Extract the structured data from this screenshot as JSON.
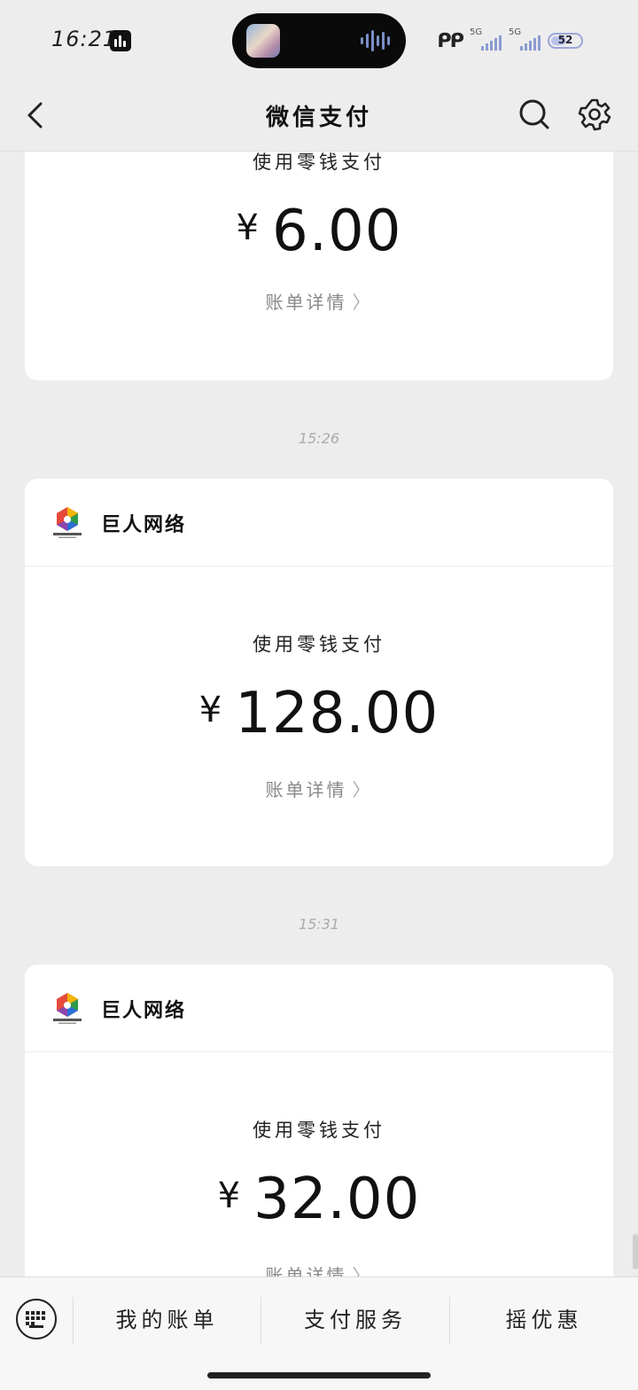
{
  "status_bar": {
    "time": "16:21",
    "signal1_label": "5G",
    "signal2_label": "5G",
    "battery": "52",
    "battery_level": 0.52
  },
  "nav": {
    "title": "微信支付"
  },
  "cards": [
    {
      "pay_method": "使用零钱支付",
      "amount": "6.00",
      "currency_symbol": "¥",
      "detail_label": "账单详情"
    },
    {
      "merchant": "巨人网络",
      "pay_method": "使用零钱支付",
      "amount": "128.00",
      "currency_symbol": "¥",
      "detail_label": "账单详情"
    },
    {
      "merchant": "巨人网络",
      "pay_method": "使用零钱支付",
      "amount": "32.00",
      "currency_symbol": "¥",
      "detail_label": "账单详情"
    }
  ],
  "timestamps": [
    "15:26",
    "15:31"
  ],
  "bottom_menu": {
    "items": [
      "我的账单",
      "支付服务",
      "摇优惠"
    ]
  },
  "colors": {
    "background": "#ededed",
    "card": "#ffffff",
    "accent_text": "#111111",
    "muted_text": "#888888"
  },
  "icons": {
    "back": "chevron-left-icon",
    "search": "search-icon",
    "settings": "gear-icon",
    "keyboard": "keyboard-icon",
    "detail_chevron": "chevron-right-icon",
    "merchant_logo": "giant-network-logo"
  }
}
